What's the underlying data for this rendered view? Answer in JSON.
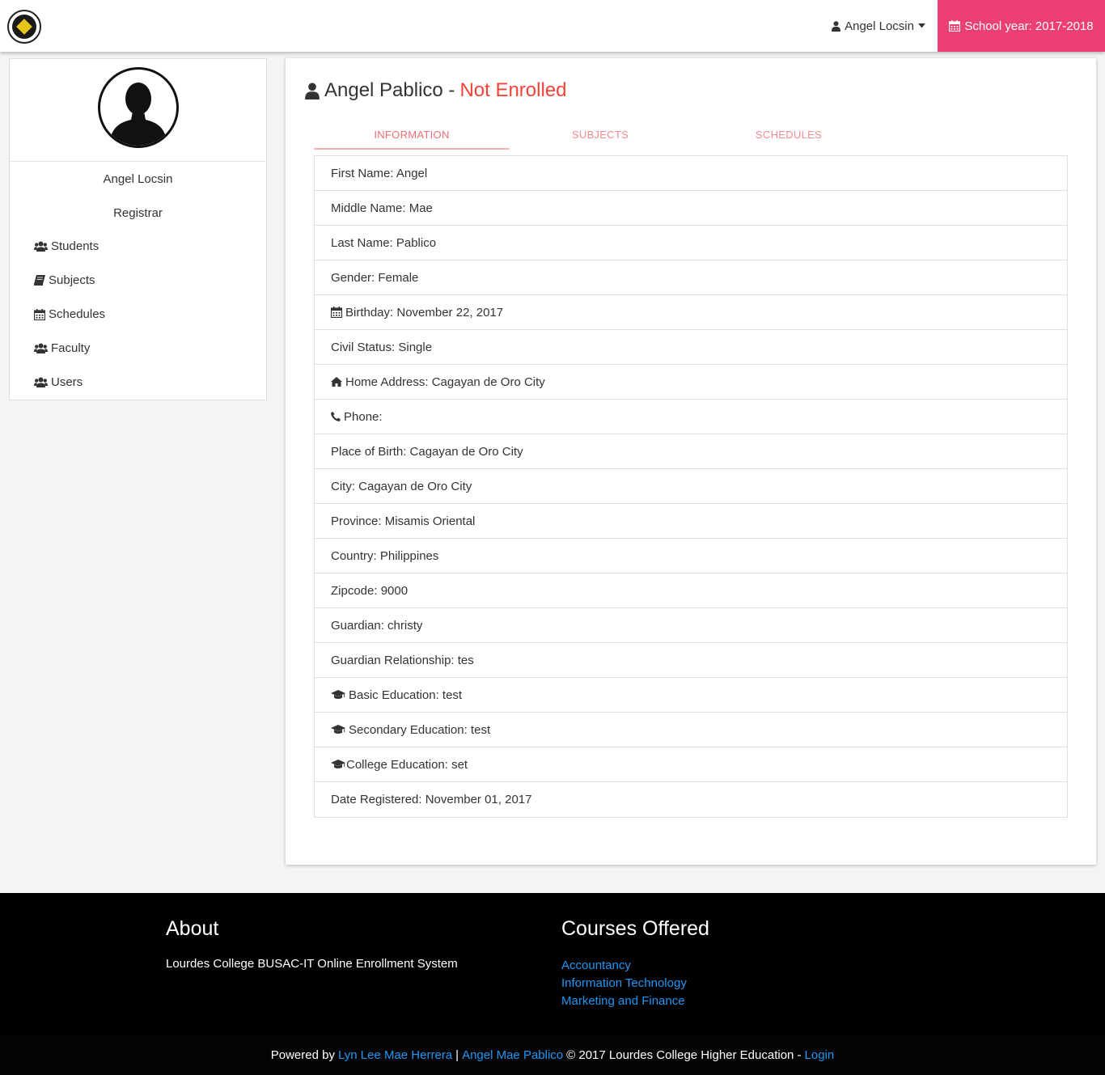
{
  "navbar": {
    "logo_icon": "school-seal-icon",
    "user_name": "Angel Locsin",
    "school_year": "School year: 2017-2018",
    "accent_color": "#ec3f74"
  },
  "sidebar": {
    "name": "Angel Locsin",
    "role": "Registrar",
    "items": [
      {
        "label": "Students",
        "icon": "users-icon"
      },
      {
        "label": "Subjects",
        "icon": "book-icon"
      },
      {
        "label": "Schedules",
        "icon": "calendar-icon"
      },
      {
        "label": "Faculty",
        "icon": "users-icon"
      },
      {
        "label": "Users",
        "icon": "users-icon"
      }
    ]
  },
  "main": {
    "student_name": "Angel Pablico -",
    "status": "Not Enrolled",
    "status_color": "#f44336",
    "tabs": [
      "INFORMATION",
      "SUBJECTS",
      "SCHEDULES"
    ],
    "active_tab": "INFORMATION",
    "info": [
      "First Name: Angel",
      "Middle Name: Mae",
      "Last Name: Pablico",
      "Gender: Female",
      "Birthday: November 22, 2017",
      "Civil Status: Single",
      "Home Address: Cagayan de Oro City",
      "Phone:",
      "Place of Birth: Cagayan de Oro City",
      "City: Cagayan de Oro City",
      "Province: Misamis Oriental",
      "Country: Philippines",
      "Zipcode: 9000",
      "Guardian: christy",
      "Guardian Relationship: tes",
      "Basic Education: test",
      "Secondary Education: test",
      "College Education: set",
      "Date Registered: November 01, 2017"
    ]
  },
  "footer": {
    "about_title": "About",
    "about_text": "Lourdes College BUSAC-IT Online Enrollment System",
    "courses_title": "Courses Offered",
    "courses": [
      "Accountancy",
      "Information Technology",
      "Marketing and Finance"
    ],
    "powered_by": "Powered by",
    "author1": "Lyn Lee Mae Herrera",
    "separator": "|",
    "author2": "Angel Mae Pablico",
    "copyright": "© 2017 Lourdes College Higher Education -",
    "login": "Login"
  }
}
